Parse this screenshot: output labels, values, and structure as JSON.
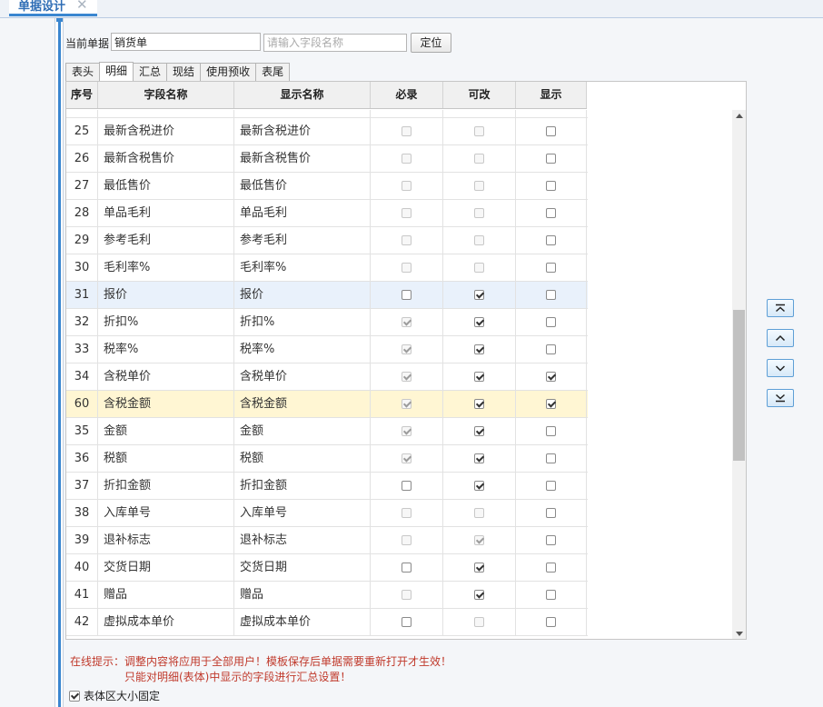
{
  "window": {
    "tab_title": "单据设计",
    "close_glyph": "✕"
  },
  "toolbar": {
    "current_doc_label": "当前单据",
    "current_doc_value": "销货单",
    "search_placeholder": "请输入字段名称",
    "locate_label": "定位"
  },
  "tabs": [
    {
      "label": "表头",
      "active": false
    },
    {
      "label": "明细",
      "active": true
    },
    {
      "label": "汇总",
      "active": false
    },
    {
      "label": "现结",
      "active": false
    },
    {
      "label": "使用预收",
      "active": false
    },
    {
      "label": "表尾",
      "active": false
    }
  ],
  "grid": {
    "headers": [
      "序号",
      "字段名称",
      "显示名称",
      "必录",
      "可改",
      "显示"
    ],
    "rows": [
      {
        "no": "25",
        "field": "最新含税进价",
        "display": "最新含税进价",
        "required": {
          "checked": false,
          "disabled": true
        },
        "editable": {
          "checked": false,
          "disabled": true
        },
        "shown": {
          "checked": false,
          "disabled": false
        }
      },
      {
        "no": "26",
        "field": "最新含税售价",
        "display": "最新含税售价",
        "required": {
          "checked": false,
          "disabled": true
        },
        "editable": {
          "checked": false,
          "disabled": true
        },
        "shown": {
          "checked": false,
          "disabled": false
        }
      },
      {
        "no": "27",
        "field": "最低售价",
        "display": "最低售价",
        "required": {
          "checked": false,
          "disabled": true
        },
        "editable": {
          "checked": false,
          "disabled": true
        },
        "shown": {
          "checked": false,
          "disabled": false
        }
      },
      {
        "no": "28",
        "field": "单品毛利",
        "display": "单品毛利",
        "required": {
          "checked": false,
          "disabled": true
        },
        "editable": {
          "checked": false,
          "disabled": true
        },
        "shown": {
          "checked": false,
          "disabled": false
        }
      },
      {
        "no": "29",
        "field": "参考毛利",
        "display": "参考毛利",
        "required": {
          "checked": false,
          "disabled": true
        },
        "editable": {
          "checked": false,
          "disabled": true
        },
        "shown": {
          "checked": false,
          "disabled": false
        }
      },
      {
        "no": "30",
        "field": "毛利率%",
        "display": "毛利率%",
        "required": {
          "checked": false,
          "disabled": true
        },
        "editable": {
          "checked": false,
          "disabled": true
        },
        "shown": {
          "checked": false,
          "disabled": false
        }
      },
      {
        "no": "31",
        "field": "报价",
        "display": "报价",
        "state": "selected",
        "required": {
          "checked": false,
          "disabled": false
        },
        "editable": {
          "checked": true,
          "disabled": false
        },
        "shown": {
          "checked": false,
          "disabled": false
        }
      },
      {
        "no": "32",
        "field": "折扣%",
        "display": "折扣%",
        "required": {
          "checked": true,
          "disabled": true
        },
        "editable": {
          "checked": true,
          "disabled": false
        },
        "shown": {
          "checked": false,
          "disabled": false
        }
      },
      {
        "no": "33",
        "field": "税率%",
        "display": "税率%",
        "required": {
          "checked": true,
          "disabled": true
        },
        "editable": {
          "checked": true,
          "disabled": false
        },
        "shown": {
          "checked": false,
          "disabled": false
        }
      },
      {
        "no": "34",
        "field": "含税单价",
        "display": "含税单价",
        "required": {
          "checked": true,
          "disabled": true
        },
        "editable": {
          "checked": true,
          "disabled": false
        },
        "shown": {
          "checked": true,
          "disabled": false
        }
      },
      {
        "no": "60",
        "field": "含税金额",
        "display": "含税金额",
        "state": "highlight",
        "required": {
          "checked": true,
          "disabled": true
        },
        "editable": {
          "checked": true,
          "disabled": false
        },
        "shown": {
          "checked": true,
          "disabled": false
        }
      },
      {
        "no": "35",
        "field": "金额",
        "display": "金额",
        "required": {
          "checked": true,
          "disabled": true
        },
        "editable": {
          "checked": true,
          "disabled": false
        },
        "shown": {
          "checked": false,
          "disabled": false
        }
      },
      {
        "no": "36",
        "field": "税额",
        "display": "税额",
        "required": {
          "checked": true,
          "disabled": true
        },
        "editable": {
          "checked": true,
          "disabled": false
        },
        "shown": {
          "checked": false,
          "disabled": false
        }
      },
      {
        "no": "37",
        "field": "折扣金额",
        "display": "折扣金额",
        "required": {
          "checked": false,
          "disabled": false
        },
        "editable": {
          "checked": true,
          "disabled": false
        },
        "shown": {
          "checked": false,
          "disabled": false
        }
      },
      {
        "no": "38",
        "field": "入库单号",
        "display": "入库单号",
        "required": {
          "checked": false,
          "disabled": true
        },
        "editable": {
          "checked": false,
          "disabled": true
        },
        "shown": {
          "checked": false,
          "disabled": false
        }
      },
      {
        "no": "39",
        "field": "退补标志",
        "display": "退补标志",
        "required": {
          "checked": false,
          "disabled": true
        },
        "editable": {
          "checked": true,
          "disabled": true
        },
        "shown": {
          "checked": false,
          "disabled": false
        }
      },
      {
        "no": "40",
        "field": "交货日期",
        "display": "交货日期",
        "required": {
          "checked": false,
          "disabled": false
        },
        "editable": {
          "checked": true,
          "disabled": false
        },
        "shown": {
          "checked": false,
          "disabled": false
        }
      },
      {
        "no": "41",
        "field": "赠品",
        "display": "赠品",
        "required": {
          "checked": false,
          "disabled": true
        },
        "editable": {
          "checked": true,
          "disabled": false
        },
        "shown": {
          "checked": false,
          "disabled": false
        }
      },
      {
        "no": "42",
        "field": "虚拟成本单价",
        "display": "虚拟成本单价",
        "required": {
          "checked": false,
          "disabled": false
        },
        "editable": {
          "checked": false,
          "disabled": true
        },
        "shown": {
          "checked": false,
          "disabled": false
        }
      }
    ]
  },
  "side_buttons": [
    {
      "name": "move-top-button",
      "icon": "move-top-icon"
    },
    {
      "name": "move-up-button",
      "icon": "move-up-icon"
    },
    {
      "name": "move-down-button",
      "icon": "move-down-icon"
    },
    {
      "name": "move-bottom-button",
      "icon": "move-bottom-icon"
    }
  ],
  "footer": {
    "tip_line1": "在线提示：调整内容将应用于全部用户！模板保存后单据需要重新打开才生效！",
    "tip_line2": "只能对明细(表体)中显示的字段进行汇总设置！",
    "fixed_size_label": "表体区大小固定",
    "fixed_size_checked": true
  },
  "colors": {
    "accent": "#3a86d0",
    "tip_red": "#c0392b",
    "selected_row": "#e9f1fb",
    "highlight_row": "#fff6d3"
  }
}
